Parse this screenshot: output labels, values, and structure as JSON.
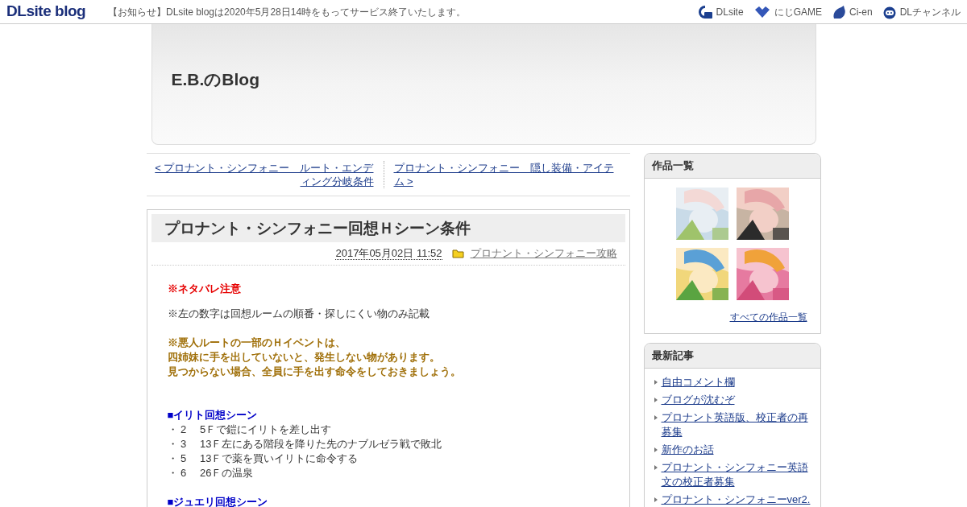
{
  "topbar": {
    "logo": "DLsite blog",
    "notice": "【お知らせ】DLsite blogは2020年5月28日14時をもってサービス終了いたします。",
    "links": [
      {
        "label": "DLsite",
        "kind": "dlsite"
      },
      {
        "label": "にじGAME",
        "kind": "niji"
      },
      {
        "label": "Ci-en",
        "kind": "cien"
      },
      {
        "label": "DLチャンネル",
        "kind": "channel"
      }
    ]
  },
  "blog_title": "E.B.のBlog",
  "pager": {
    "prev": "< プロナント・シンフォニー　ルート・エンディング分岐条件",
    "next": "プロナント・シンフォニー　隠し装備・アイテム >"
  },
  "article": {
    "title": "プロナント・シンフォニー回想Ｈシーン条件",
    "date": "2017年05月02日 11:52",
    "category": "プロナント・シンフォニー攻略",
    "body": [
      {
        "kind": "warning",
        "lines": [
          "※ネタバレ注意"
        ]
      },
      {
        "kind": "note",
        "lines": [
          "※左の数字は回想ルームの順番・探しにくい物のみ記載"
        ]
      },
      {
        "kind": "highlight",
        "lines": [
          "※悪人ルートの一部のＨイベントは、",
          "四姉妹に手を出していないと、発生しない物があります。",
          "見つからない場合、全員に手を出す命令をしておきましょう。"
        ]
      },
      {
        "kind": "heading",
        "lines": [
          "■イリト回想シーン"
        ]
      },
      {
        "kind": "list",
        "lines": [
          "・ 2　 5Ｆで鎧にイリトを差し出す",
          "・ 3　 13Ｆ左にある階段を降りた先のナブルゼラ戦で敗北",
          "・ 5　 13Ｆで薬を買いイリトに命令する",
          "・ 6　 26Ｆの温泉"
        ]
      },
      {
        "kind": "heading",
        "lines": [
          "■ジュエリ回想シーン"
        ]
      }
    ]
  },
  "sidebar": [
    {
      "kind": "works",
      "title": "作品一覧",
      "more": "すべての作品一覧"
    },
    {
      "kind": "recent",
      "title": "最新記事",
      "items": [
        "自由コメント欄",
        "ブログが沈むぞ",
        "プロナント英語版、校正者の再募集",
        "新作のお話",
        "プロナント・シンフォニー英語文の校正者募集",
        "プロナント・シンフォニーver2."
      ]
    }
  ]
}
